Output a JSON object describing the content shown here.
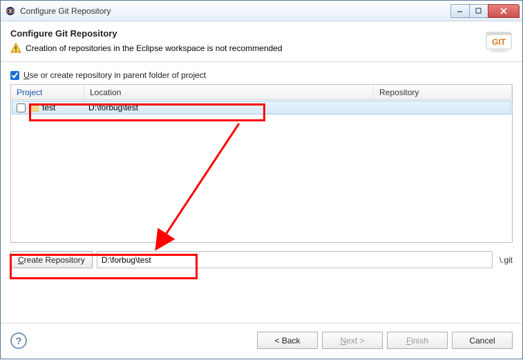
{
  "window": {
    "title": "Configure Git Repository"
  },
  "header": {
    "title": "Configure Git Repository",
    "warning": "Creation of repositories in the Eclipse workspace is not recommended"
  },
  "options": {
    "use_parent_label_pre": "U",
    "use_parent_label_post": "se or create repository in parent folder of project",
    "use_parent_checked": true
  },
  "table": {
    "headers": {
      "project": "Project",
      "location": "Location",
      "repository": "Repository"
    },
    "rows": [
      {
        "checked": false,
        "name": "test",
        "location": "D:\\forbug\\test",
        "repository": ""
      }
    ]
  },
  "action": {
    "create_repo_pre": "C",
    "create_repo_post": "reate Repository",
    "path_value": "D:\\forbug\\test",
    "git_suffix": "\\.git"
  },
  "buttons": {
    "back": "< Back",
    "next_pre": "N",
    "next_post": "ext >",
    "finish_pre": "F",
    "finish_post": "inish",
    "cancel": "Cancel"
  },
  "git_logo_text": "GIT",
  "help_glyph": "?"
}
